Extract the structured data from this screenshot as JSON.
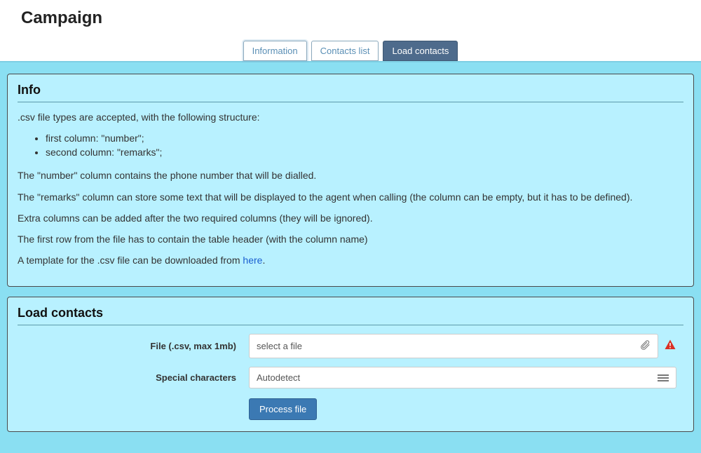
{
  "page_title": "Campaign",
  "tabs": {
    "information": "Information",
    "contacts_list": "Contacts list",
    "load_contacts": "Load contacts"
  },
  "info_panel": {
    "title": "Info",
    "intro": ".csv file types are accepted, with the following structure:",
    "cols": {
      "first": "first column: \"number\";",
      "second": "second column: \"remarks\";"
    },
    "p_number": "The \"number\" column contains the phone number that will be dialled.",
    "p_remarks": "The \"remarks\" column can store some text that will be displayed to the agent when calling (the column can be empty, but it has to be defined).",
    "p_extra": "Extra columns can be added after the two required columns (they will be ignored).",
    "p_header": "The first row from the file has to contain the table header (with the column name)",
    "p_template_prefix": "A template for the .csv file can be downloaded from ",
    "p_template_link": "here",
    "p_template_suffix": "."
  },
  "load_panel": {
    "title": "Load contacts",
    "file_label": "File (.csv, max 1mb)",
    "file_placeholder": "select a file",
    "special_label": "Special characters",
    "special_value": "Autodetect",
    "process_button": "Process file"
  }
}
